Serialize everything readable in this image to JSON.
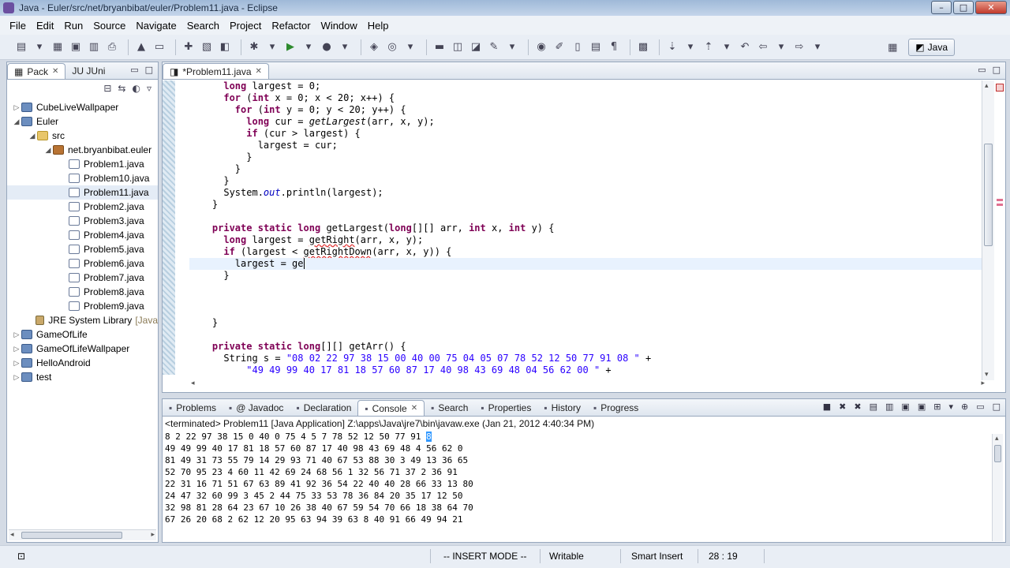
{
  "window": {
    "title": "Java - Euler/src/net/bryanbibat/euler/Problem11.java - Eclipse"
  },
  "menu": [
    "File",
    "Edit",
    "Run",
    "Source",
    "Navigate",
    "Search",
    "Project",
    "Refactor",
    "Window",
    "Help"
  ],
  "perspective": {
    "label": "Java"
  },
  "left_panel": {
    "tabs": [
      "Pack",
      "JU JUni"
    ],
    "tree": [
      {
        "label": "CubeLiveWallpaper",
        "type": "project",
        "depth": 0,
        "expanded": false
      },
      {
        "label": "Euler",
        "type": "project",
        "depth": 0,
        "expanded": true
      },
      {
        "label": "src",
        "type": "folder",
        "depth": 1,
        "expanded": true
      },
      {
        "label": "net.bryanbibat.euler",
        "type": "pkg",
        "depth": 2,
        "expanded": true
      },
      {
        "label": "Problem1.java",
        "type": "java",
        "depth": 3
      },
      {
        "label": "Problem10.java",
        "type": "java",
        "depth": 3
      },
      {
        "label": "Problem11.java",
        "type": "java",
        "depth": 3,
        "selected": true
      },
      {
        "label": "Problem2.java",
        "type": "java",
        "depth": 3
      },
      {
        "label": "Problem3.java",
        "type": "java",
        "depth": 3
      },
      {
        "label": "Problem4.java",
        "type": "java",
        "depth": 3
      },
      {
        "label": "Problem5.java",
        "type": "java",
        "depth": 3
      },
      {
        "label": "Problem6.java",
        "type": "java",
        "depth": 3
      },
      {
        "label": "Problem7.java",
        "type": "java",
        "depth": 3
      },
      {
        "label": "Problem8.java",
        "type": "java",
        "depth": 3
      },
      {
        "label": "Problem9.java",
        "type": "java",
        "depth": 3
      },
      {
        "label": "JRE System Library",
        "suffix": "[Java",
        "type": "lib",
        "depth": 1
      },
      {
        "label": "GameOfLife",
        "type": "project",
        "depth": 0,
        "expanded": false
      },
      {
        "label": "GameOfLifeWallpaper",
        "type": "project",
        "depth": 0,
        "expanded": false
      },
      {
        "label": "HelloAndroid",
        "type": "project",
        "depth": 0,
        "expanded": false
      },
      {
        "label": "test",
        "type": "project",
        "depth": 0,
        "expanded": false
      }
    ]
  },
  "editor": {
    "tab_label": "*Problem11.java",
    "lines": [
      "      long largest = 0;",
      "      for (int x = 0; x < 20; x++) {",
      "        for (int y = 0; y < 20; y++) {",
      "          long cur = getLargest(arr, x, y);",
      "          if (cur > largest) {",
      "            largest = cur;",
      "          }",
      "        }",
      "      }",
      "      System.out.println(largest);",
      "    }",
      "",
      "    private static long getLargest(long[][] arr, int x, int y) {",
      "      long largest = getRight(arr, x, y);",
      "      if (largest < getRightDown(arr, x, y)) {",
      "        largest = ge",
      "      }",
      "",
      "",
      "",
      "    }",
      "",
      "    private static long[][] getArr() {",
      "      String s = \"08 02 22 97 38 15 00 40 00 75 04 05 07 78 52 12 50 77 91 08 \" +",
      "          \"49 49 99 40 17 81 18 57 60 87 17 40 98 43 69 48 04 56 62 00 \" +"
    ]
  },
  "bottom_panel": {
    "tabs": [
      "Problems",
      "@ Javadoc",
      "Declaration",
      "Console",
      "Search",
      "Properties",
      "History",
      "Progress"
    ],
    "active_tab": "Console",
    "console_header": "<terminated> Problem11 [Java Application] Z:\\apps\\Java\\jre7\\bin\\javaw.exe (Jan 21, 2012 4:40:34 PM)",
    "first_line": "8 2 22 97 38 15 0 40 0 75 4 5 7 78 52 12 50 77 91 ",
    "first_line_highlight": "8",
    "output_lines": [
      "49 49 99 40 17 81 18 57 60 87 17 40 98 43 69 48 4 56 62 0",
      "81 49 31 73 55 79 14 29 93 71 40 67 53 88 30 3 49 13 36 65",
      "52 70 95 23 4 60 11 42 69 24 68 56 1 32 56 71 37 2 36 91",
      "22 31 16 71 51 67 63 89 41 92 36 54 22 40 40 28 66 33 13 80",
      "24 47 32 60 99 3 45 2 44 75 33 53 78 36 84 20 35 17 12 50",
      "32 98 81 28 64 23 67 10 26 38 40 67 59 54 70 66 18 38 64 70",
      "67 26 20 68 2 62 12 20 95 63 94 39 63 8 40 91 66 49 94 21"
    ]
  },
  "statusbar": {
    "mode": "-- INSERT MODE --",
    "writable": "Writable",
    "insert": "Smart Insert",
    "position": "28 : 19"
  },
  "colors": {
    "keyword": "#7f0055",
    "string": "#2a00ff",
    "current_line": "#e8f2fe",
    "selection": "#3399ff"
  }
}
